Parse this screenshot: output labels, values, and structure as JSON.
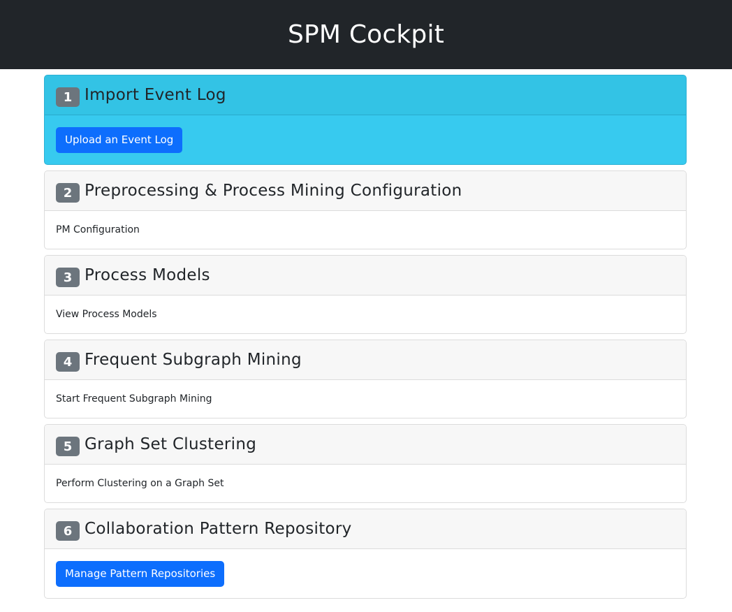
{
  "navbar": {
    "title": "SPM Cockpit"
  },
  "steps": [
    {
      "number": "1",
      "title": "Import Event Log",
      "action": "Upload an Event Log"
    },
    {
      "number": "2",
      "title": "Preprocessing & Process Mining Configuration",
      "action": "PM Configuration"
    },
    {
      "number": "3",
      "title": "Process Models",
      "action": "View Process Models"
    },
    {
      "number": "4",
      "title": "Frequent Subgraph Mining",
      "action": "Start Frequent Subgraph Mining"
    },
    {
      "number": "5",
      "title": "Graph Set Clustering",
      "action": "Perform Clustering on a Graph Set"
    },
    {
      "number": "6",
      "title": "Collaboration Pattern Repository",
      "action": "Manage Pattern Repositories"
    }
  ],
  "colors": {
    "navbar": "#212529",
    "active_card": "#36c9ee",
    "primary_button": "#0d6efd",
    "step_badge": "#6c757d"
  }
}
